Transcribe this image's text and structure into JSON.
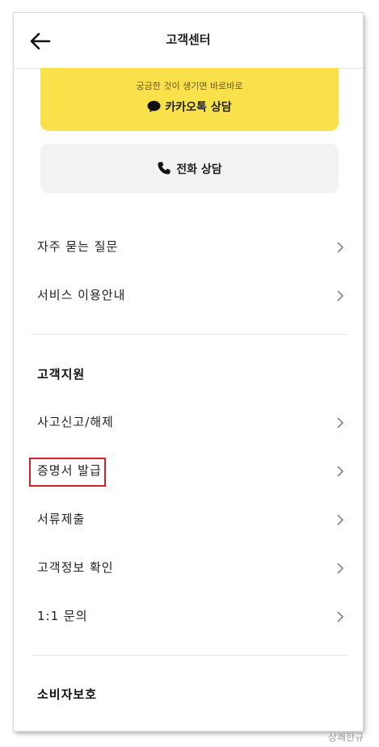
{
  "header": {
    "title": "고객센터"
  },
  "kakao": {
    "subtitle": "궁금한 것이 생기면 바로바로",
    "label": "카카오톡 상담",
    "color": "#f9e14b"
  },
  "phone": {
    "label": "전화 상담"
  },
  "menu_top": [
    {
      "label": "자주 묻는 질문"
    },
    {
      "label": "서비스 이용안내"
    }
  ],
  "support": {
    "title": "고객지원",
    "items": [
      {
        "label": "사고신고/해제"
      },
      {
        "label": "증명서 발급"
      },
      {
        "label": "서류제출"
      },
      {
        "label": "고객정보 확인"
      },
      {
        "label": "1:1 문의"
      }
    ]
  },
  "consumer": {
    "title": "소비자보호"
  },
  "highlight_color": "#d6202a",
  "watermark": "상쾌한규"
}
